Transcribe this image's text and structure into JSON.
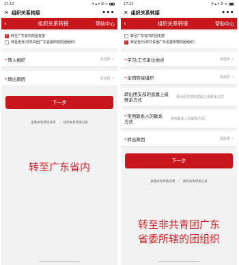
{
  "left": {
    "status": {
      "time": "17:13",
      "icons": "◔ ▴ ▾ ☰ ≋",
      "battery": ""
    },
    "wx": {
      "close": "✕",
      "title": "组织关系转接",
      "more": "•••"
    },
    "header": {
      "back": "‹",
      "title": "组织关系转接",
      "help": "帮助中心"
    },
    "options": [
      {
        "label": "转至广东省内的团支部",
        "checked": true
      },
      {
        "label": "转至省外(非共青团广东省委所辖的团组织)",
        "checked": false
      }
    ],
    "rows": [
      {
        "label": "转入组织",
        "required": true,
        "value": "请选择",
        "chevron": "›"
      },
      {
        "label": "转出原因",
        "required": true,
        "value": "请选择",
        "chevron": "›"
      }
    ],
    "next_button": "下一步",
    "links": {
      "guide": "查看关系转接说明",
      "sep": "|",
      "records": "组织关系转接记录"
    },
    "caption": "转至广东省内"
  },
  "right": {
    "status": {
      "time": "17:13",
      "icons": "◔ ▴ ▾ ☰ ≋",
      "battery": ""
    },
    "wx": {
      "close": "✕",
      "title": "组织关系转接",
      "more": "•••"
    },
    "header": {
      "back": "‹",
      "title": "组织关系转接",
      "help": "帮助中心"
    },
    "options": [
      {
        "label": "转至广东省内的团支部",
        "checked": false
      },
      {
        "label": "转至省外(非共青团广东省委所辖的团组织)",
        "checked": true
      }
    ],
    "rows": [
      {
        "label": "学习/工作单位地点",
        "required": true,
        "value": "请选择",
        "chevron": "›"
      },
      {
        "label": "全团转接组织",
        "required": true,
        "value": "请选择",
        "chevron": "›"
      },
      {
        "label": "转出团支部的直属上级联系方式",
        "required": false,
        "value": "转出团支部的直属上级联系方式",
        "chevron": ""
      },
      {
        "label": "常用联系人的联系方式",
        "required": true,
        "value": "常用联系人的联系方式",
        "chevron": ""
      },
      {
        "label": "转出原因",
        "required": true,
        "value": "请选择",
        "chevron": "›"
      }
    ],
    "next_button": "下一步",
    "links": {
      "guide": "查看关系转接说明",
      "sep": "|",
      "records": "组织关系转接记录"
    },
    "caption_line1": "转至非共青团广东",
    "caption_line2": "省委所辖的团组织"
  },
  "colors": {
    "brand_red": "#c8161d",
    "caption_red": "#d21f26",
    "page_bg": "#f2f2f2"
  }
}
